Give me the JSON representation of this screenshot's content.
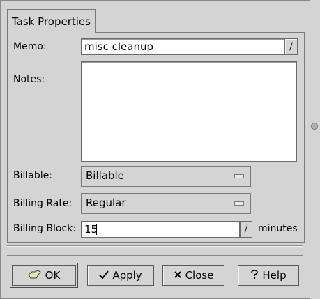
{
  "tab": {
    "label": "Task Properties"
  },
  "memo": {
    "label": "Memo:",
    "value": "misc cleanup",
    "dropdown_glyph": "/"
  },
  "notes": {
    "label": "Notes:",
    "value": ""
  },
  "billable": {
    "label": "Billable:",
    "selected": "Billable"
  },
  "billing_rate": {
    "label": "Billing Rate:",
    "selected": "Regular"
  },
  "billing_block": {
    "label": "Billing Block:",
    "value": "15",
    "unit": "minutes",
    "dropdown_glyph": "/"
  },
  "buttons": {
    "ok": {
      "label": "OK",
      "icon": "ok-hand-icon"
    },
    "apply": {
      "label": "Apply",
      "icon": "checkmark-icon"
    },
    "close": {
      "label": "Close",
      "icon": "x-icon"
    },
    "help": {
      "label": "Help",
      "icon": "question-icon"
    }
  }
}
